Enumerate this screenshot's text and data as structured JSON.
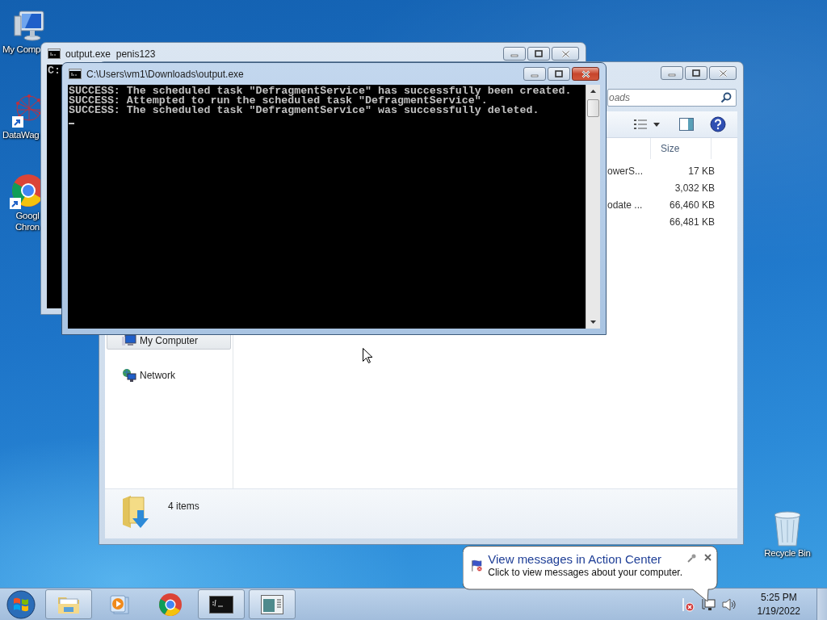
{
  "desktop_icons": [
    {
      "kind": "computer",
      "lines": [
        "My Comp"
      ]
    },
    {
      "kind": "molecule-app",
      "lines": [
        "DataWag"
      ]
    },
    {
      "kind": "chrome",
      "lines": [
        "Googl",
        "Chron"
      ]
    },
    {
      "kind": "recycle-bin",
      "lines": [
        "Recycle Bin"
      ]
    }
  ],
  "windows": {
    "back_console": {
      "title": "output.exe  penis123",
      "active": false,
      "lines": [
        "C:"
      ]
    },
    "explorer": {
      "active": false,
      "search": {
        "placeholder": "oads"
      },
      "columns": [
        {
          "label": "Size"
        }
      ],
      "rows": [
        {
          "name": "owerS...",
          "size": "17 KB"
        },
        {
          "size": "3,032 KB"
        },
        {
          "name": "odate ...",
          "size": "66,460 KB"
        },
        {
          "size": "66,481 KB"
        }
      ],
      "nav_items": [
        {
          "kind": "computer",
          "label": "My Computer",
          "selected": true
        },
        {
          "kind": "network",
          "label": "Network",
          "selected": false
        }
      ],
      "status_bar": {
        "text": "4 items"
      }
    },
    "front_console": {
      "title": "C:\\Users\\vm1\\Downloads\\output.exe",
      "active": true,
      "cursor": true,
      "lines": [
        "SUCCESS: The scheduled task \"DefragmentService\" has successfully been created.",
        "SUCCESS: Attempted to run the scheduled task \"DefragmentService\".",
        "SUCCESS: The scheduled task \"DefragmentService\" was successfully deleted."
      ]
    }
  },
  "notification": {
    "title": "View messages in Action Center",
    "text": "Click to view messages about your computer."
  },
  "taskbar": {
    "items": [
      {
        "kind": "explorer",
        "running": true
      },
      {
        "kind": "media-player",
        "running": false
      },
      {
        "kind": "chrome",
        "running": false
      },
      {
        "kind": "console",
        "running": true
      },
      {
        "kind": "app-window",
        "running": true
      }
    ],
    "tray": {
      "time": "5:25 PM",
      "date": "1/19/2022"
    }
  }
}
